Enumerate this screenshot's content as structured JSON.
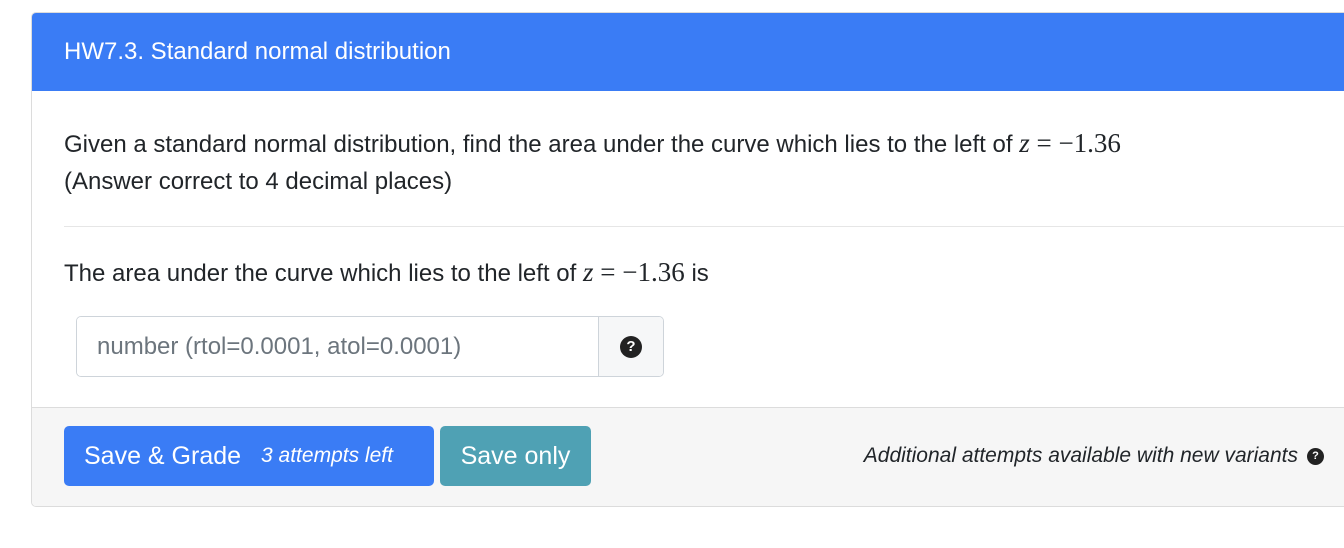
{
  "question": {
    "title": "HW7.3. Standard normal distribution",
    "prompt_text": "Given a standard normal distribution, find the area under the curve which lies to the left of",
    "z_var": "z",
    "equals": "=",
    "z_value": "−1.36",
    "prompt_note": "(Answer correct to 4 decimal places)",
    "answer_prefix": "The area under the curve which lies to the left of",
    "answer_suffix": "is"
  },
  "input": {
    "value": "",
    "placeholder": "number (rtol=0.0001, atol=0.0001)",
    "help_icon": "question-circle-icon",
    "help_glyph": "?"
  },
  "footer": {
    "grade_button_label": "Save & Grade",
    "attempts_label": "3 attempts left",
    "save_button_label": "Save only",
    "note": "Additional attempts available with new variants",
    "note_icon": "question-circle-icon",
    "note_glyph": "?"
  },
  "colors": {
    "header_bg": "#3a7cf5",
    "grade_button": "#3a7cf5",
    "save_button": "#4fa1b4",
    "footer_bg": "#f6f6f6"
  }
}
